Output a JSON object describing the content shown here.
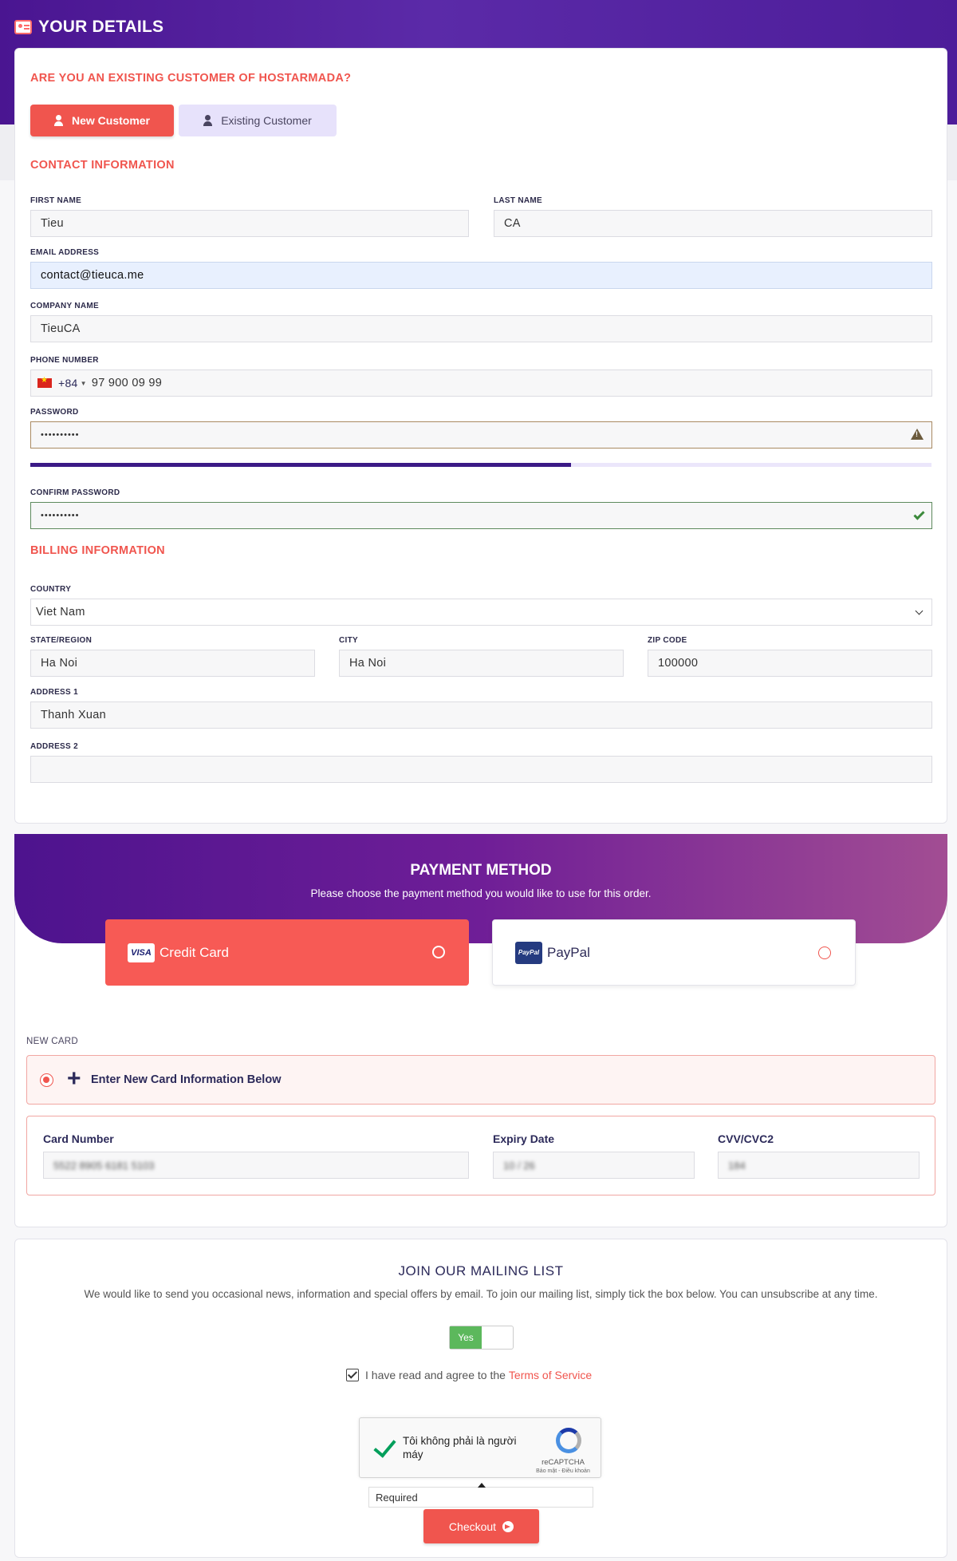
{
  "header": {
    "title": "YOUR DETAILS",
    "icon": "id-card-icon"
  },
  "customer_type": {
    "question": "ARE YOU AN EXISTING CUSTOMER OF HOSTARMADA?",
    "new_label": "New Customer",
    "existing_label": "Existing Customer",
    "selected": "New Customer"
  },
  "contact": {
    "heading": "CONTACT INFORMATION",
    "first_name": {
      "label": "FIRST NAME",
      "value": "Tieu"
    },
    "last_name": {
      "label": "LAST NAME",
      "value": "CA"
    },
    "email": {
      "label": "EMAIL ADDRESS",
      "value": "contact@tieuca.me"
    },
    "company": {
      "label": "COMPANY NAME",
      "value": "TieuCA"
    },
    "phone": {
      "label": "PHONE NUMBER",
      "country_code": "+84",
      "value": "97 900 09 99"
    },
    "password": {
      "label": "PASSWORD",
      "value": "••••••••••",
      "strength": 0.6
    },
    "confirm_password": {
      "label": "CONFIRM PASSWORD",
      "value": "••••••••••"
    }
  },
  "billing": {
    "heading": "BILLING INFORMATION",
    "country": {
      "label": "COUNTRY",
      "value": "Viet Nam"
    },
    "state": {
      "label": "STATE/REGION",
      "value": "Ha Noi"
    },
    "city": {
      "label": "CITY",
      "value": "Ha Noi"
    },
    "zip": {
      "label": "ZIP CODE",
      "value": "100000"
    },
    "address1": {
      "label": "ADDRESS 1",
      "value": "Thanh Xuan"
    },
    "address2": {
      "label": "ADDRESS 2",
      "value": ""
    }
  },
  "payment": {
    "title": "PAYMENT METHOD",
    "subtitle": "Please choose the payment method you would like to use for this order.",
    "credit_card_label": "Credit Card",
    "credit_card_badge": "VISA",
    "paypal_label": "PayPal",
    "paypal_badge": "PayPal",
    "new_card_label": "NEW CARD",
    "new_card_option": "Enter New Card Information Below",
    "card_number": {
      "label": "Card Number",
      "value": "5522 8905 6181 5103"
    },
    "expiry": {
      "label": "Expiry Date",
      "value": "10 / 26"
    },
    "cvv": {
      "label": "CVV/CVC2",
      "value": "184"
    }
  },
  "mailing": {
    "title": "JOIN OUR MAILING LIST",
    "text": "We would like to send you occasional news, information and special offers by email. To join our mailing list, simply tick the box below. You can unsubscribe at any time.",
    "toggle_label": "Yes",
    "tos_text": "I have read and agree to the",
    "tos_link": "Terms of Service"
  },
  "captcha": {
    "text": "Tôi không phải là người máy",
    "brand": "reCAPTCHA",
    "links": "Bảo mật - Điều khoản",
    "required": "Required"
  },
  "checkout": {
    "label": "Checkout"
  },
  "colors": {
    "accent": "#f0554e",
    "brand_purple": "#4a1591",
    "success": "#5cb85c"
  }
}
